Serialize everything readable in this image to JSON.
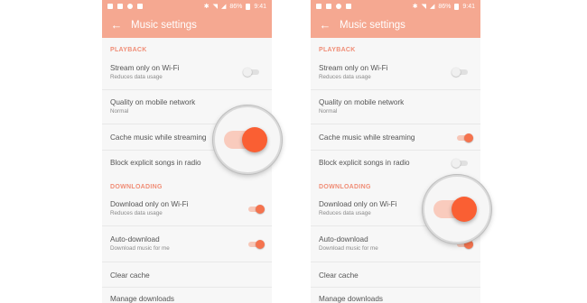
{
  "status_bar": {
    "battery": "86%",
    "time": "9:41"
  },
  "screens": [
    {
      "toolbar_title": "Music settings",
      "playback_header": "PLAYBACK",
      "downloading_header": "DOWNLOADING",
      "items": [
        {
          "title": "Stream only on Wi-Fi",
          "subtitle": "Reduces data usage",
          "toggle": "off"
        },
        {
          "title": "Quality on mobile network",
          "subtitle": "Normal"
        },
        {
          "title": "Cache music while streaming",
          "toggle": "on"
        },
        {
          "title": "Block explicit songs in radio",
          "toggle": "off"
        },
        {
          "title": "Download only on Wi-Fi",
          "subtitle": "Reduces data usage",
          "toggle": "on"
        },
        {
          "title": "Auto-download",
          "subtitle": "Download music for me",
          "toggle": "on"
        },
        {
          "title": "Clear cache"
        },
        {
          "title": "Manage downloads"
        }
      ],
      "zoomed_toggle": "Cache music while streaming"
    },
    {
      "toolbar_title": "Music settings",
      "playback_header": "PLAYBACK",
      "downloading_header": "DOWNLOADING",
      "items": [
        {
          "title": "Stream only on Wi-Fi",
          "subtitle": "Reduces data usage",
          "toggle": "off"
        },
        {
          "title": "Quality on mobile network",
          "subtitle": "Normal"
        },
        {
          "title": "Cache music while streaming",
          "toggle": "on"
        },
        {
          "title": "Block explicit songs in radio",
          "toggle": "off"
        },
        {
          "title": "Download only on Wi-Fi",
          "subtitle": "Reduces data usage",
          "toggle": "on"
        },
        {
          "title": "Auto-download",
          "subtitle": "Download music for me",
          "toggle": "on"
        },
        {
          "title": "Clear cache"
        },
        {
          "title": "Manage downloads"
        }
      ],
      "zoomed_toggle": "Download only on Wi-Fi"
    }
  ],
  "colors": {
    "accent": "#f5a891",
    "toggle_on": "#f5734e",
    "section_header": "#f08d76"
  }
}
